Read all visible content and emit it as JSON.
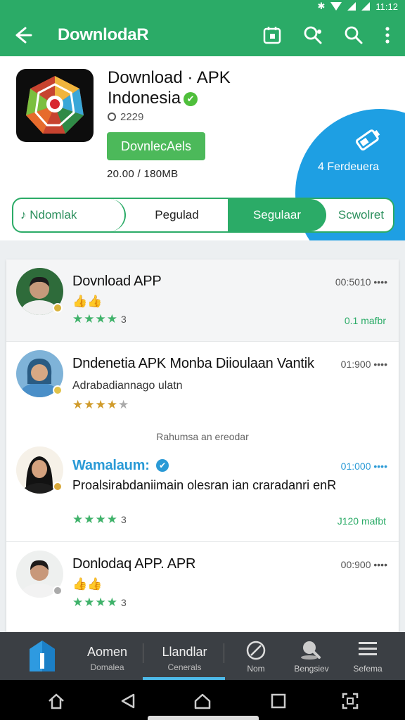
{
  "status_bar": {
    "time": "11:12"
  },
  "app_bar": {
    "title": "DownlodaR"
  },
  "app": {
    "name_line1": "Download · APK",
    "name_line2": "Indonesia",
    "verified_mark": "✔",
    "count": "2229",
    "download_label": "DovnlecAels",
    "size_text": "20.00 / 180MB"
  },
  "promo": {
    "text": "4 Ferdeuera"
  },
  "tabs": [
    {
      "label": "Ndomlak",
      "icon": "♪"
    },
    {
      "label": "Pegulad"
    },
    {
      "label": "Segulaar"
    },
    {
      "label": "Scwolret"
    }
  ],
  "list": {
    "separator": "Rahumsa an ereodar",
    "items": [
      {
        "title": "Dovnload APP",
        "time": "00:5010 ••••",
        "thumbs": "👍👍",
        "stars_text": "3",
        "meta": "0.1 mafbr",
        "colors": {
          "bg": "#2e6b3a",
          "face": "#c69a7b",
          "shirt": "#f0f0f0",
          "hair": "#1c1c1c"
        }
      },
      {
        "title": "Dndenetia APK Monba Diioulaan Vantik",
        "time": "01:900 ••••",
        "subtitle": "Adrabadiannago ulatn",
        "stars_text": "",
        "colors": {
          "bg": "#7fb3d8",
          "face": "#d7a884",
          "shirt": "#4a8fc8",
          "hair": "#2a5b82"
        }
      },
      {
        "title": "Wamalaum:",
        "verified": "✔",
        "time": "01:000 ••••",
        "desc": "Proalsirabdaniimain olesran ian craradanri enR",
        "stars_text": "3",
        "meta": "J120 mafbt",
        "colors": {
          "bg": "#f6f1e8",
          "face": "#d4a27f",
          "shirt": "#1d1d1d",
          "hair": "#121212"
        }
      },
      {
        "title": "Donlodaq APP. APR",
        "time": "00:900 ••••",
        "thumbs": "👍👍",
        "stars_text": "3",
        "colors": {
          "bg": "#eef0ef",
          "face": "#c8987a",
          "shirt": "#f2f2f2",
          "hair": "#1e1b1a"
        }
      }
    ]
  },
  "bottom_nav": [
    {
      "label": "Aomen",
      "sub": "Domalea"
    },
    {
      "label": "Llandlar",
      "sub": "Cenerals"
    },
    {
      "label": "Nom"
    },
    {
      "label": "Bengsiev"
    },
    {
      "label": "Sefema"
    }
  ],
  "colors": {
    "primary": "#2bab67",
    "download_button": "#4cb95a",
    "promo": "#1e9fe3",
    "accent_blue": "#2a9ad6",
    "bottom_nav": "#3b3f44"
  },
  "icons": {
    "app_bar": [
      "back-arrow-icon",
      "calendar-icon",
      "search-settings-icon",
      "search-icon",
      "more-vert-icon"
    ],
    "system": [
      "home-outline-icon",
      "back-triangle-icon",
      "home-circle-icon",
      "recents-square-icon",
      "scan-icon"
    ]
  }
}
